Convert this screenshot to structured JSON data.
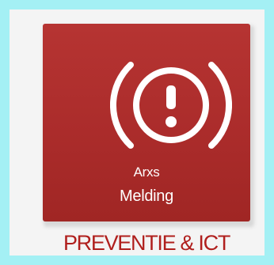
{
  "tile": {
    "icon": "alarm-warning-icon",
    "line1": "Arxs",
    "line2": "Melding"
  },
  "footer": {
    "text": "PREVENTIE & ICT"
  },
  "colors": {
    "page_background": "#a4f0f4",
    "card_background": "#f4f4f4",
    "tile_red": "#ab2c2b",
    "footer_red": "#b01f1d",
    "icon_white": "#ffffff"
  }
}
